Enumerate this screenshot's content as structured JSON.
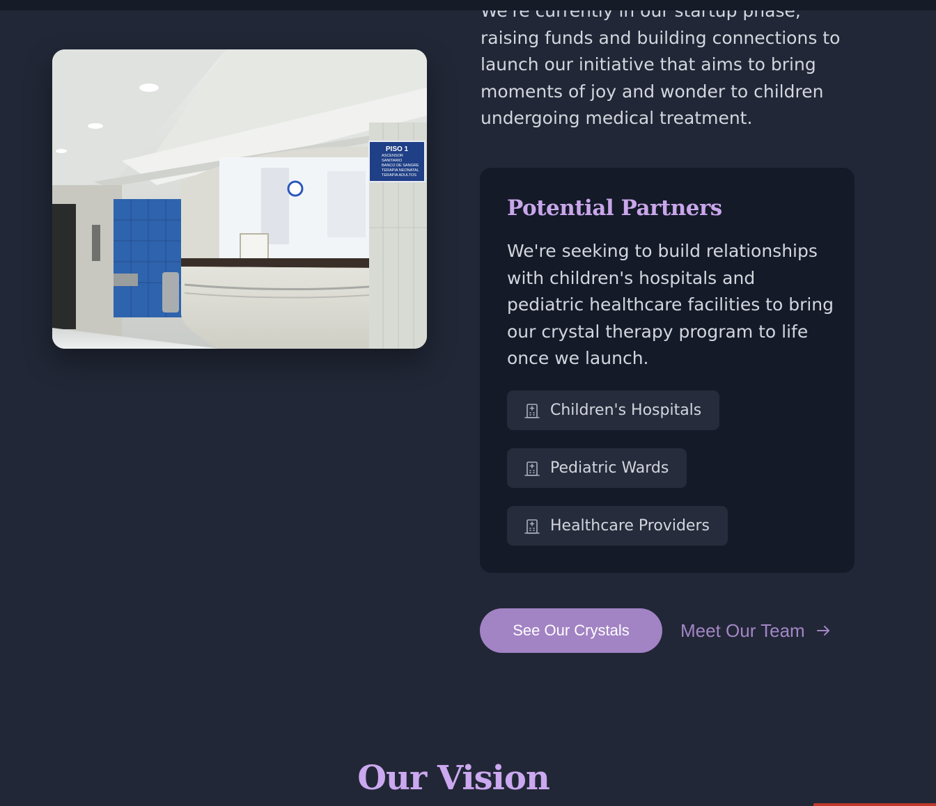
{
  "about": {
    "intro_text": "We're currently in our startup phase, raising funds and building connections to launch our initiative that aims to bring moments of joy and wonder to children undergoing medical treatment."
  },
  "photo": {
    "sign_title": "PISO 1",
    "sign_lines": [
      "ASCENSOR",
      "SANITARIO",
      "BANCO DE SANGRE",
      "TERAPIA NEONATAL",
      "TERAPIA ADULTOS"
    ]
  },
  "partners": {
    "title": "Potential Partners",
    "description": "We're seeking to build relationships with children's hospitals and pediatric healthcare facilities to bring our crystal therapy program to life once we launch.",
    "items": [
      {
        "label": "Children's Hospitals",
        "icon": "hospital-icon"
      },
      {
        "label": "Pediatric Wards",
        "icon": "hospital-icon"
      },
      {
        "label": "Healthcare Providers",
        "icon": "hospital-icon"
      }
    ]
  },
  "cta": {
    "primary_label": "See Our Crystals",
    "secondary_label": "Meet Our Team",
    "secondary_icon": "arrow-right-icon"
  },
  "vision": {
    "title": "Our Vision"
  },
  "colors": {
    "background": "#212736",
    "card": "#141a28",
    "accent": "#a283c4",
    "heading": "#c9a6ea"
  }
}
